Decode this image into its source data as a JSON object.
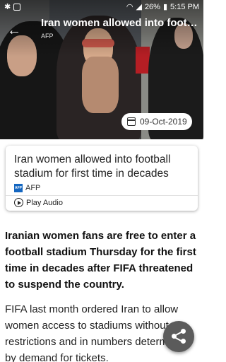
{
  "status_bar": {
    "battery": "26%",
    "time": "5:15 PM",
    "icons": [
      "bluetooth-icon",
      "app-icon",
      "wifi-icon",
      "signal-icon",
      "battery-icon"
    ]
  },
  "toolbar": {
    "back_icon": "back-arrow-icon",
    "title": "Iran women allowed into football stadium for first time in decades",
    "subtitle": "AFP"
  },
  "hero": {
    "date": "09-Oct-2019",
    "date_icon": "calendar-icon"
  },
  "card": {
    "headline": "Iran women allowed into football stadium for first time in decades",
    "source_logo_text": "AFP",
    "source": "AFP",
    "play_audio_label": "Play Audio"
  },
  "article": {
    "lead": "Iranian women fans are free to enter a football stadium Thursday for the first time in decades after FIFA threatened to suspend the country.",
    "body": "FIFA last month ordered Iran to allow women access to stadiums without restrictions and in numbers determined by demand for tickets."
  },
  "fab": {
    "icon": "share-icon"
  }
}
